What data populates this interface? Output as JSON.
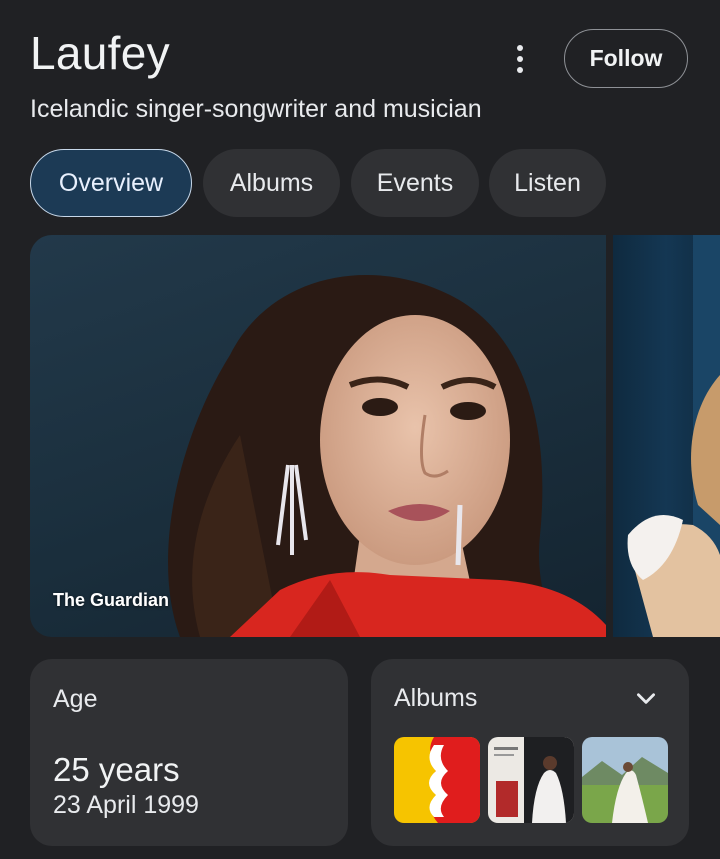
{
  "header": {
    "title": "Laufey",
    "subtitle": "Icelandic singer-songwriter and musician",
    "follow_label": "Follow"
  },
  "tabs": [
    {
      "label": "Overview",
      "active": true
    },
    {
      "label": "Albums",
      "active": false
    },
    {
      "label": "Events",
      "active": false
    },
    {
      "label": "Listen",
      "active": false
    }
  ],
  "gallery": {
    "main_image_source": "The Guardian"
  },
  "age_card": {
    "label": "Age",
    "value": "25 years",
    "date": "23 April 1999"
  },
  "albums_card": {
    "label": "Albums",
    "expand_icon": "chevron-down-icon"
  },
  "colors": {
    "background": "#202124",
    "surface": "#303134",
    "active_tab": "#1c3a55",
    "accent_red": "#d8261f"
  }
}
